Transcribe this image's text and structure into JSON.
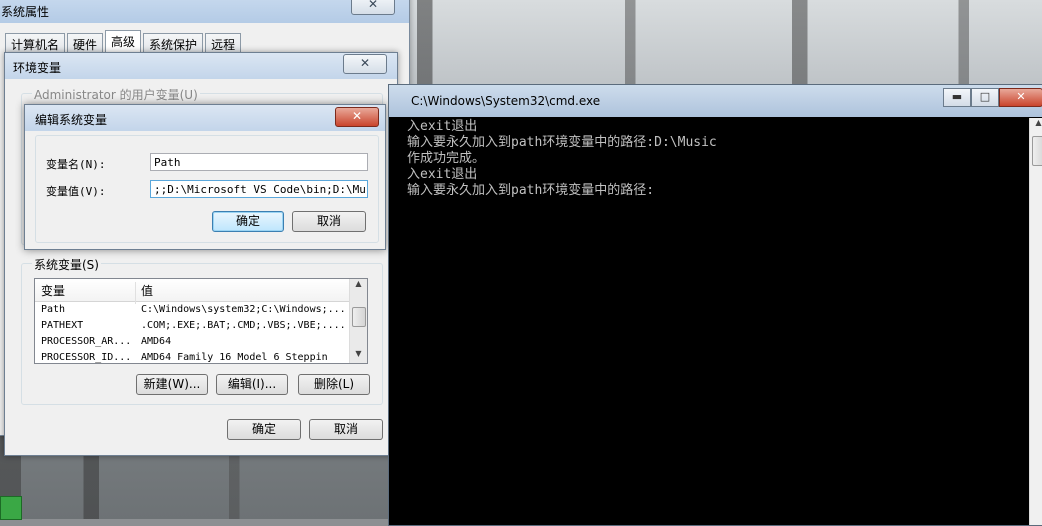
{
  "system_properties": {
    "title": "系统属性",
    "tabs": [
      {
        "label": "计算机名"
      },
      {
        "label": "硬件"
      },
      {
        "label": "高级"
      },
      {
        "label": "系统保护"
      },
      {
        "label": "远程"
      }
    ],
    "close_glyph": "✕"
  },
  "env_vars": {
    "title": "环境变量",
    "close_glyph": "✕",
    "user_vars_label": "Administrator 的用户变量(U)",
    "system_vars_label": "系统变量(S)",
    "columns": {
      "name": "变量",
      "value": "值"
    },
    "rows": [
      {
        "name": "Path",
        "value": "C:\\Windows\\system32;C:\\Windows;..."
      },
      {
        "name": "PATHEXT",
        "value": ".COM;.EXE;.BAT;.CMD;.VBS;.VBE;...."
      },
      {
        "name": "PROCESSOR_AR...",
        "value": "AMD64"
      },
      {
        "name": "PROCESSOR_ID...",
        "value": "AMD64 Family 16 Model 6 Steppin"
      }
    ],
    "new_button": "新建(W)...",
    "edit_button": "编辑(I)...",
    "delete_button": "删除(L)",
    "ok_button": "确定",
    "cancel_button": "取消"
  },
  "edit_var": {
    "title": "编辑系统变量",
    "close_glyph": "✕",
    "name_label": "变量名(N):",
    "name_value": "Path",
    "value_label": "变量值(V):",
    "value_value": ";;D:\\Microsoft VS Code\\bin;D:\\Music",
    "ok_button": "确定",
    "cancel_button": "取消"
  },
  "cmd": {
    "title": "C:\\Windows\\System32\\cmd.exe",
    "minimize_glyph": "▬",
    "maximize_glyph": "□",
    "close_glyph": "✕",
    "lines": [
      "入exit退出",
      "输入要永久加入到path环境变量中的路径:D:\\Music",
      "作成功完成。",
      "入exit退出",
      "输入要永久加入到path环境变量中的路径:"
    ]
  },
  "colors": {
    "accent": "#3c7fb1",
    "close": "#c9442c",
    "console_bg": "#000000",
    "console_fg": "#c0c0c0"
  }
}
